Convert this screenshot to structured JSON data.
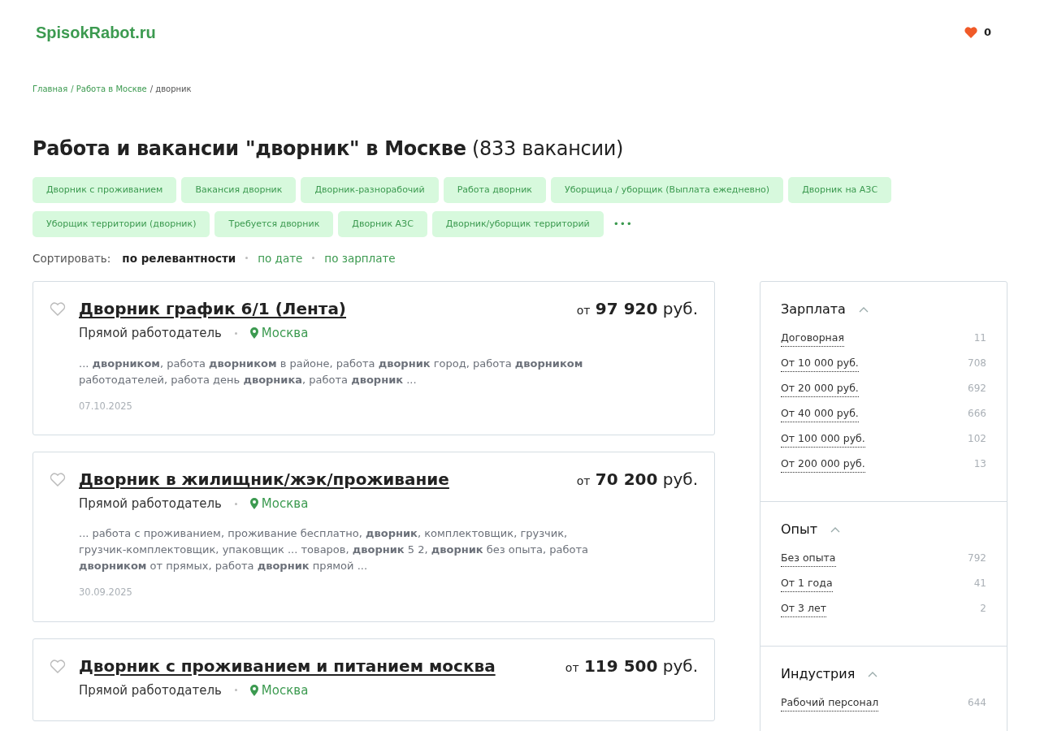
{
  "header": {
    "logo": "SpisokRabot.ru",
    "favorites_count": "0"
  },
  "breadcrumbs": [
    {
      "label": "Главная",
      "kind": "link"
    },
    {
      "label": "/ Работа в Москве",
      "kind": "link"
    },
    {
      "label": "/ дворник",
      "kind": "current"
    }
  ],
  "heading": "**Работа и вакансии \"дворник\" в Москве** (833 вакансии)",
  "tags": [
    "Дворник с проживанием",
    "Вакансия дворник",
    "Дворник-разнорабочий",
    "Работа дворник",
    "Уборщица / уборщик (Выплата ежедневно)",
    "Дворник на АЗС",
    "Уборщик территории (дворник)",
    "Требуется дворник",
    "Дворник АЗС",
    "Дворник/уборщик территорий"
  ],
  "more_tags": "•••",
  "sort": {
    "label": "Сортировать:",
    "options": [
      {
        "label": "по релевантности",
        "selected": true
      },
      {
        "label": "по дате",
        "selected": false
      },
      {
        "label": "по зарплате",
        "selected": false
      }
    ]
  },
  "vacancies": [
    {
      "title": "Дворник график 6/1 (Лента)",
      "favorite": false,
      "salary_prefix": "от",
      "salary": "97 920",
      "currency": "руб.",
      "employer": "Прямой работодатель",
      "city": "Москва",
      "snippet": "... **дворником**, работа **дворником** в районе, работа **дворник** город, работа **дворником** работодателей, работа день **дворника**, работа **дворник** ...",
      "date": "07.10.2025"
    },
    {
      "title": "Дворник в жилищник/жэк/проживание",
      "favorite": false,
      "salary_prefix": "от",
      "salary": "70 200",
      "currency": "руб.",
      "employer": "Прямой работодатель",
      "city": "Москва",
      "snippet": "... работа с проживанием, проживание бесплатно, **дворник**, комплектовщик, грузчик, грузчик-комплектовщик, упаковщик ... товаров, **дворник** 5 2, **дворник** без опыта, работа **дворником** от прямых, работа **дворник** прямой ...",
      "date": "30.09.2025"
    },
    {
      "title": "Дворник с проживанием и питанием москва",
      "favorite": false,
      "salary_prefix": "от",
      "salary": "119 500",
      "currency": "руб.",
      "employer": "Прямой работодатель",
      "city": "Москва"
    }
  ],
  "filters": [
    {
      "title": "Зарплата",
      "expanded": true,
      "items": [
        {
          "label": "Договорная",
          "count": "11"
        },
        {
          "label": "От 10 000 руб.",
          "count": "708"
        },
        {
          "label": "От 20 000 руб.",
          "count": "692"
        },
        {
          "label": "От 40 000 руб.",
          "count": "666"
        },
        {
          "label": "От 100 000 руб.",
          "count": "102"
        },
        {
          "label": "От 200 000 руб.",
          "count": "13"
        }
      ]
    },
    {
      "title": "Опыт",
      "expanded": true,
      "items": [
        {
          "label": "Без опыта",
          "count": "792"
        },
        {
          "label": "От 1 года",
          "count": "41"
        },
        {
          "label": "От 3 лет",
          "count": "2"
        }
      ]
    },
    {
      "title": "Индустрия",
      "expanded": true,
      "items": [
        {
          "label": "Рабочий персонал",
          "count": "644"
        }
      ]
    }
  ]
}
